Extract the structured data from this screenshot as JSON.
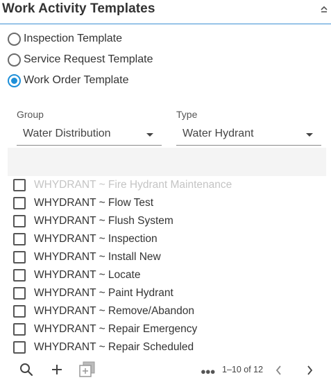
{
  "header": {
    "title": "Work Activity Templates",
    "collapse_icon": "chevron-up-icon"
  },
  "template_type": {
    "options": [
      {
        "label": "Inspection Template",
        "checked": false
      },
      {
        "label": "Service Request Template",
        "checked": false
      },
      {
        "label": "Work Order Template",
        "checked": true
      }
    ]
  },
  "filters": {
    "group": {
      "label": "Group",
      "value": "Water Distribution"
    },
    "type": {
      "label": "Type",
      "value": "Water Hydrant"
    }
  },
  "templates": {
    "items": [
      {
        "label": "WHYDRANT ~ Fire Hydrant Maintenance",
        "checked": false,
        "disabled": true
      },
      {
        "label": "WHYDRANT ~ Flow Test",
        "checked": false,
        "disabled": false
      },
      {
        "label": "WHYDRANT ~ Flush System",
        "checked": false,
        "disabled": false
      },
      {
        "label": "WHYDRANT ~ Inspection",
        "checked": false,
        "disabled": false
      },
      {
        "label": "WHYDRANT ~ Install New",
        "checked": false,
        "disabled": false
      },
      {
        "label": "WHYDRANT ~ Locate",
        "checked": false,
        "disabled": false
      },
      {
        "label": "WHYDRANT ~ Paint Hydrant",
        "checked": false,
        "disabled": false
      },
      {
        "label": "WHYDRANT ~ Remove/Abandon",
        "checked": false,
        "disabled": false
      },
      {
        "label": "WHYDRANT ~ Repair Emergency",
        "checked": false,
        "disabled": false
      },
      {
        "label": "WHYDRANT ~ Repair Scheduled",
        "checked": false,
        "disabled": false
      }
    ]
  },
  "footer": {
    "icons": [
      "search-icon",
      "add-icon",
      "multi-add-icon",
      "more-icon",
      "previous-page-icon",
      "next-page-icon"
    ],
    "pager_text": "1–10 of 12"
  },
  "colors": {
    "accent": "#1e8fd8",
    "divider": "#3c8fd4",
    "disabled_text": "#c4c4c4"
  }
}
